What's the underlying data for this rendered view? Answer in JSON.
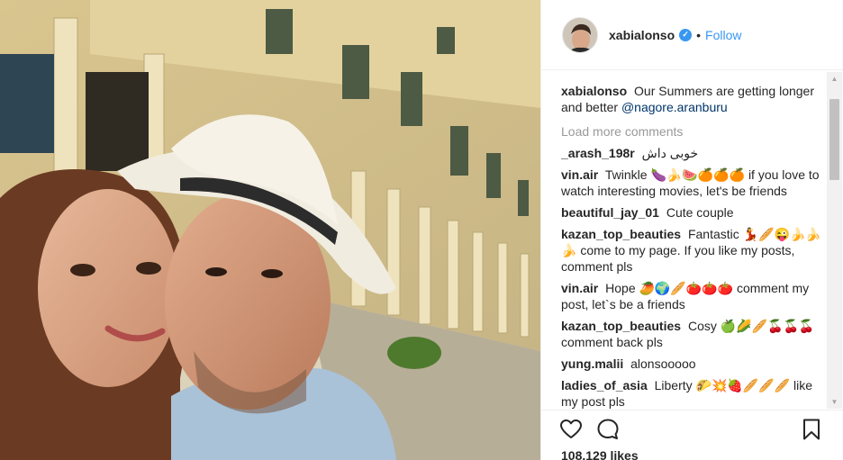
{
  "post": {
    "author": "xabialonso",
    "follow_label": "Follow",
    "separator": "•",
    "verified_mark": "✓",
    "caption_user": "xabialonso",
    "caption_text": "Our Summers are getting longer and better",
    "caption_mention": "@nagore.aranburu",
    "load_more": "Load more comments",
    "likes": "108.129 likes"
  },
  "comments": [
    {
      "user": "_arash_198r",
      "text": "خوبی داش"
    },
    {
      "user": "vin.air",
      "text": "Twinkle 🍆🍌🍉🍊🍊🍊 if you love to watch interesting movies, let's be friends"
    },
    {
      "user": "beautiful_jay_01",
      "text": "Cute couple"
    },
    {
      "user": "kazan_top_beauties",
      "text": "Fantastic 💃🥖😜🍌🍌🍌 come to my page. If you like my posts, comment pls"
    },
    {
      "user": "vin.air",
      "text": "Hope 🥭🌍🥖🍅🍅🍅 comment my post, let`s be a friends"
    },
    {
      "user": "kazan_top_beauties",
      "text": "Cosy 🍏🌽🥖🍒🍒🍒 comment back pls"
    },
    {
      "user": "yung.malii",
      "text": "alonsooooo"
    },
    {
      "user": "ladies_of_asia",
      "text": "Liberty 🌮💥🍓🥖🥖🥖 like my post pls"
    }
  ],
  "icons": {
    "like": "heart-icon",
    "comment": "comment-bubble-icon",
    "save": "bookmark-icon",
    "verified": "verified-badge-icon"
  },
  "colors": {
    "accent": "#3897f0",
    "mention": "#003569",
    "muted": "#999999"
  }
}
